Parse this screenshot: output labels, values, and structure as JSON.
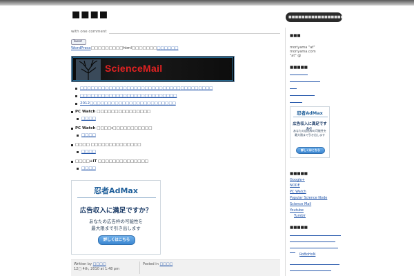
{
  "header": {
    "site_title": "■■■■",
    "search_placeholder": "■■■■■■■■■■■■■■■■■■■"
  },
  "post": {
    "comment_count": "with one comment",
    "tweet_label": "Tweet",
    "intro_link": "WordPress",
    "intro_text": "□□□□□□□□□html□□□□□□□",
    "intro_link2": "□□□□□□",
    "banner_text": "ScienceMail",
    "top_links": [
      "□□□□□□□□□□□□□□□□□□□□□□□□□□□□□□□□□□□□□",
      "□□□□□□□□□□□□□□□□□□□□□□□□□□□",
      "2012□□□□□□□□□□□□□□□□□□□□□□□□"
    ],
    "groups": [
      {
        "head": "PC Watch □□□□□□□□□□□□□□□",
        "link": "□□□□"
      },
      {
        "head": "PC Watch □□□□:□□□□□□□□□□□",
        "link": "□□□□"
      },
      {
        "head": "□□□□ □□□□□□□□□□□□□□",
        "link": "□□□□"
      },
      {
        "head": "□□□□+IT □□□□□□□□□□□□□□",
        "link": "□□□□"
      }
    ],
    "ad": {
      "logo": "忍者AdMax",
      "headline": "広告収入に満足ですか？",
      "copy1": "あなたの広告枠の可能性を",
      "copy2": "最大限まで引き出します",
      "button": "詳しくはこちら"
    },
    "footer": {
      "written_by_label": "Written by",
      "author": "□□□□",
      "date": "12□ 4th, 2010 at 1:48 pm",
      "posted_in_label": "Posted in",
      "category": "□□□□"
    }
  },
  "sidebar": {
    "title1": "■■■",
    "contact_line1": "moriyama \"at\"",
    "contact_line2": "moriyama.com",
    "contact_line3": "\"at\"   @",
    "title2": "■■■■■",
    "title3": "■■■■■",
    "links": [
      "Google+",
      "NODE",
      "PC Watch",
      "Popular Science Node",
      "Science Mail",
      "Youtube",
      "Tumblr"
    ],
    "title4": "■■■■■",
    "robohon": "RoBoHoN"
  }
}
